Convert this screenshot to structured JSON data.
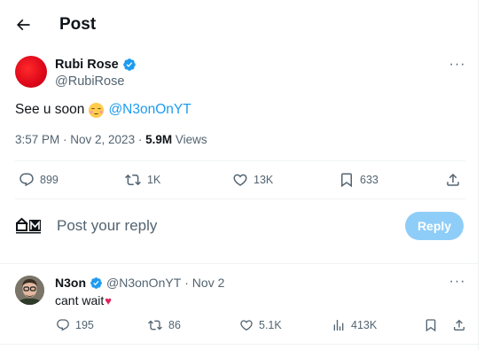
{
  "header": {
    "title": "Post"
  },
  "post": {
    "author_name": "Rubi Rose",
    "author_handle": "@RubiRose",
    "text": "See u soon",
    "emoji": "smiling-face-emoji",
    "mention": "@N3onOnYT",
    "time": "3:57 PM · Nov 2, 2023 · ",
    "views_count": "5.9M",
    "views_label": " Views",
    "stats": {
      "replies": "899",
      "reposts": "1K",
      "likes": "13K",
      "bookmarks": "633"
    }
  },
  "composer": {
    "placeholder": "Post your reply",
    "button": "Reply"
  },
  "reply": {
    "name": "N3on",
    "handle": "@N3onOnYT",
    "date": "· Nov 2",
    "text": "cant wait",
    "emoji": "♥",
    "stats": {
      "replies": "195",
      "reposts": "86",
      "likes": "5.1K",
      "views": "413K"
    }
  },
  "colors": {
    "accent": "#1d9bf0",
    "secondary_text": "#536471",
    "divider": "#eff3f4",
    "reply_button_disabled": "#8ecdf8"
  }
}
